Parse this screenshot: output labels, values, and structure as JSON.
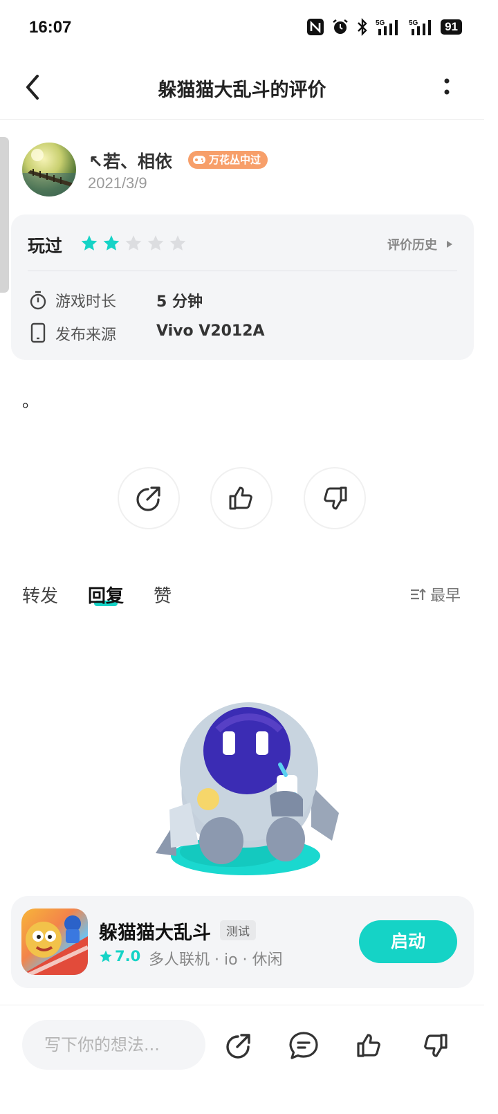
{
  "status_bar": {
    "time": "16:07",
    "battery": "91"
  },
  "header": {
    "title": "躲猫猫大乱斗的评价"
  },
  "author": {
    "name": "↖若、相依",
    "badge": "万花丛中过",
    "date": "2021/3/9"
  },
  "play_card": {
    "played_label": "玩过",
    "rating": 2,
    "rating_max": 5,
    "history_label": "评价历史",
    "rows": [
      {
        "label": "游戏时长",
        "value": "5 分钟"
      },
      {
        "label": "发布来源",
        "value": "Vivo V2012A"
      }
    ]
  },
  "review": {
    "text": "。"
  },
  "tabs": [
    {
      "label": "转发"
    },
    {
      "label": "回复"
    },
    {
      "label": "赞"
    }
  ],
  "sort": {
    "label": "最早"
  },
  "game": {
    "name": "躲猫猫大乱斗",
    "tag": "测试",
    "score": "7.0",
    "genre": "多人联机 · io · 休闲",
    "launch_label": "启动"
  },
  "bottom_bar": {
    "input_placeholder": "写下你的想法..."
  },
  "colors": {
    "accent": "#15d3c6",
    "badge": "#f79f6a",
    "card_bg": "#f4f5f7"
  }
}
